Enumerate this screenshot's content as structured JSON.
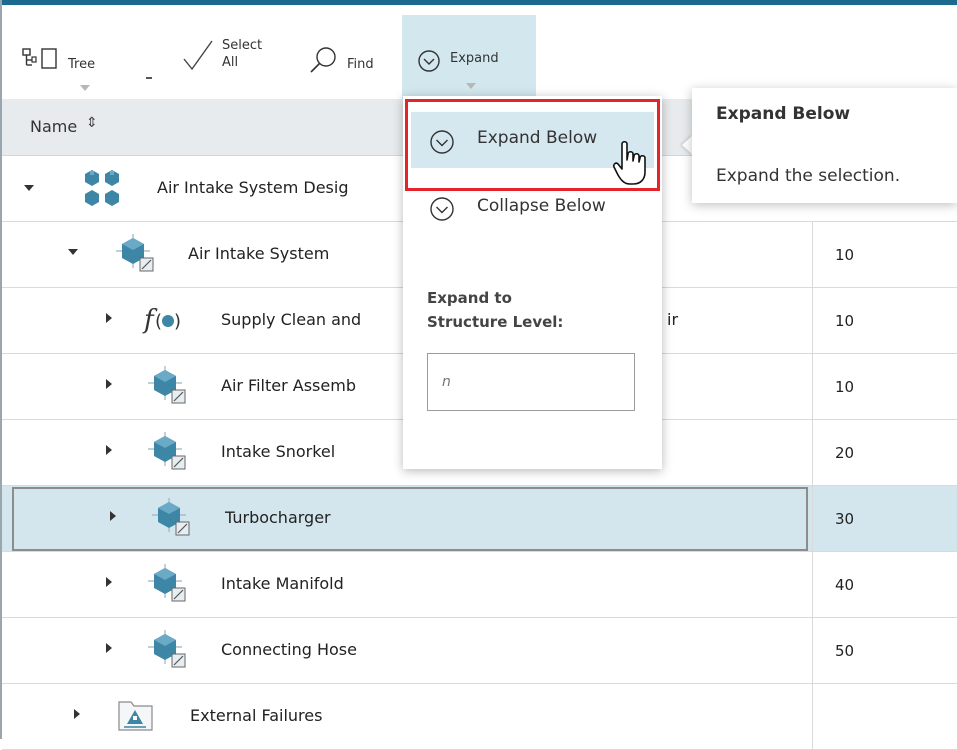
{
  "toolbar": {
    "tree_label": "Tree",
    "select_all_label_1": "Select",
    "select_all_label_2": "All",
    "find_label": "Find",
    "expand_label": "Expand"
  },
  "table": {
    "column_name": "Name",
    "rows": [
      {
        "label": "Air Intake System Desig",
        "value": "",
        "icon": "cluster-icon"
      },
      {
        "label": "Air Intake System",
        "value": "10",
        "icon": "component-icon"
      },
      {
        "label": "Supply Clean and",
        "label_tail": "ir",
        "value": "10",
        "icon": "function-icon"
      },
      {
        "label": "Air Filter Assemb",
        "value": "10",
        "icon": "component-icon"
      },
      {
        "label": "Intake Snorkel",
        "value": "20",
        "icon": "component-icon"
      },
      {
        "label": "Turbocharger",
        "value": "30",
        "icon": "component-icon"
      },
      {
        "label": "Intake Manifold",
        "value": "40",
        "icon": "component-icon"
      },
      {
        "label": "Connecting Hose",
        "value": "50",
        "icon": "component-icon"
      },
      {
        "label": "External Failures",
        "value": "",
        "icon": "folder-icon"
      }
    ]
  },
  "menu": {
    "expand_below": "Expand Below",
    "collapse_below": "Collapse Below",
    "level_label_1": "Expand to",
    "level_label_2": "Structure Level:",
    "level_placeholder": "n"
  },
  "tooltip": {
    "title": "Expand Below",
    "body": "Expand the selection."
  },
  "colors": {
    "accent": "#1d6a91",
    "selection": "#d4e6ed",
    "highlight_box": "#e3242b",
    "icon_blue": "#3d86a6"
  }
}
